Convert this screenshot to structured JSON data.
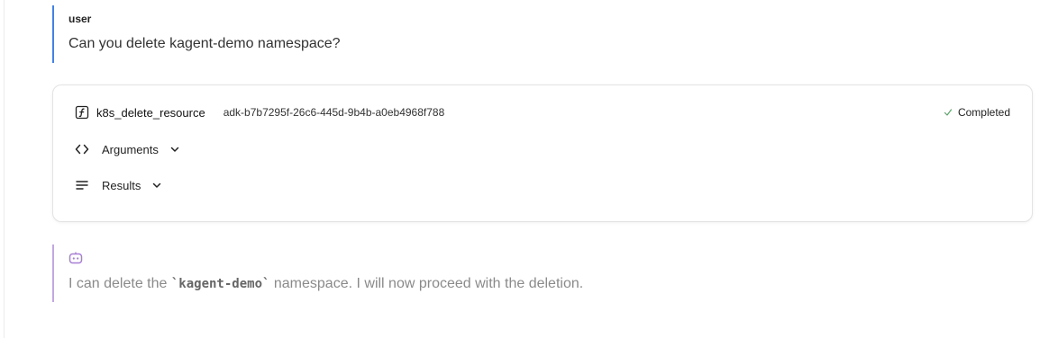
{
  "user_message": {
    "role_label": "user",
    "text": "Can you delete kagent-demo namespace?"
  },
  "tool_call": {
    "icon": "function-icon",
    "name": "k8s_delete_resource",
    "call_id": "adk-b7b7295f-26c6-445d-9b4b-a0eb4968f788",
    "status_label": "Completed",
    "sections": {
      "arguments_label": "Arguments",
      "results_label": "Results"
    }
  },
  "agent_message": {
    "icon": "bot-icon",
    "text_before": "I can delete the ",
    "code": "`kagent-demo`",
    "text_after": " namespace. I will now proceed with the deletion."
  },
  "colors": {
    "user_accent": "#3b82f6",
    "agent_accent": "#c4a5e6"
  }
}
